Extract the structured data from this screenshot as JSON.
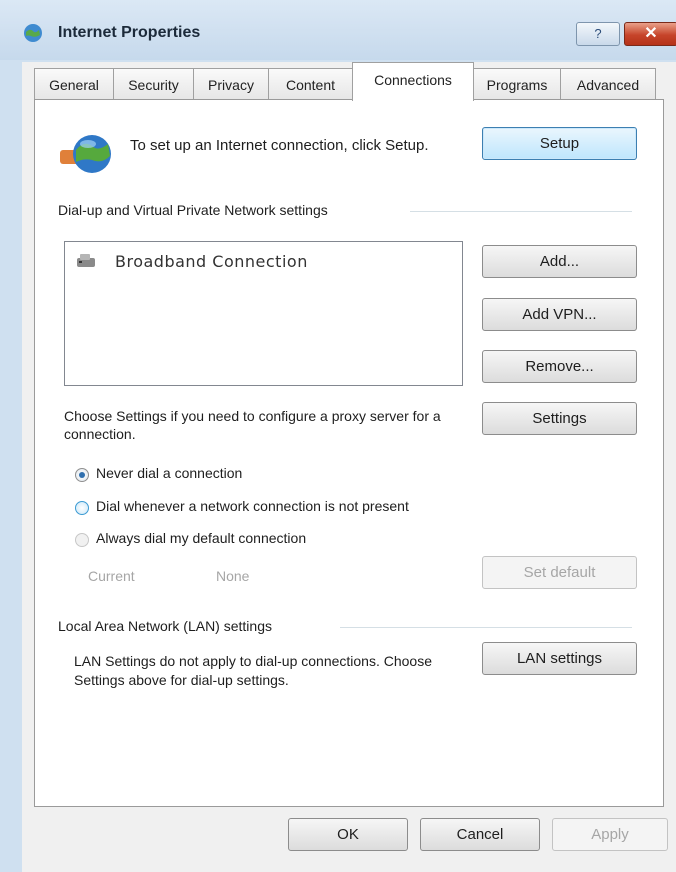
{
  "window": {
    "title": "Internet Properties",
    "help_label": "?",
    "close_label": "✕"
  },
  "tabs": [
    {
      "label": "General"
    },
    {
      "label": "Security"
    },
    {
      "label": "Privacy"
    },
    {
      "label": "Content"
    },
    {
      "label": "Connections"
    },
    {
      "label": "Programs"
    },
    {
      "label": "Advanced"
    }
  ],
  "active_tab": "Connections",
  "setup": {
    "text": "To set up an Internet connection, click Setup.",
    "button": "Setup"
  },
  "dialup": {
    "heading": "Dial-up and Virtual Private Network settings",
    "connections": [
      "Broadband Connection"
    ],
    "add_button": "Add...",
    "add_vpn_button": "Add VPN...",
    "remove_button": "Remove...",
    "settings_text": "Choose Settings if you need to configure a proxy server for a connection.",
    "settings_button": "Settings",
    "options": [
      {
        "label": "Never dial a connection",
        "checked": true
      },
      {
        "label": "Dial whenever a network connection is not present",
        "checked": false
      },
      {
        "label": "Always dial my default connection",
        "checked": false
      }
    ],
    "current_label": "Current",
    "current_value": "None",
    "set_default_button": "Set default"
  },
  "lan": {
    "heading": "Local Area Network (LAN) settings",
    "text": "LAN Settings do not apply to dial-up connections. Choose Settings above for dial-up settings.",
    "button": "LAN settings"
  },
  "footer": {
    "ok_button": "OK",
    "cancel_button": "Cancel",
    "apply_button": "Apply"
  },
  "colors": {
    "title_bar": "#cfe0f0",
    "close_button": "#c6442a",
    "focus_border": "#3c7fb1"
  }
}
